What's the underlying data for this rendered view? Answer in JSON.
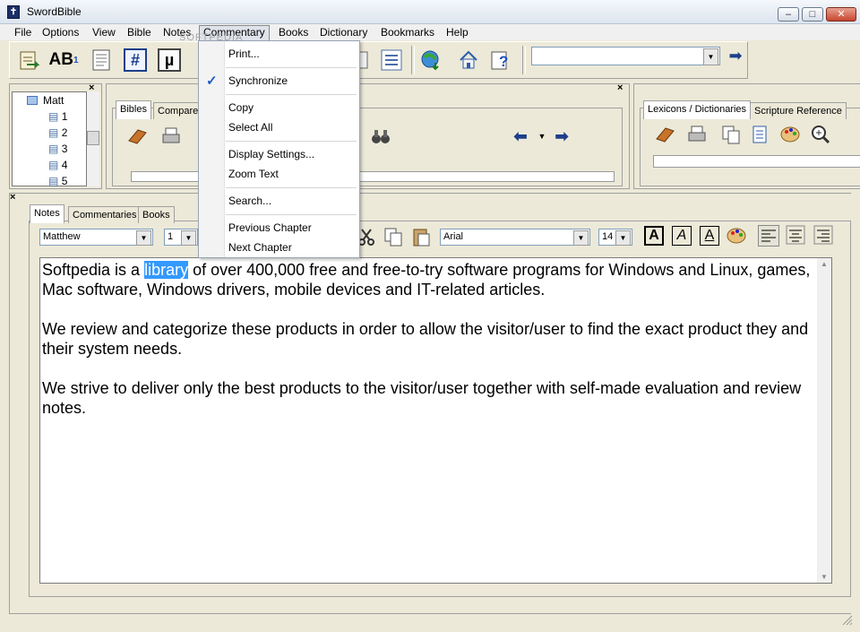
{
  "window": {
    "title": "SwordBible",
    "app_icon_glyph": "✝"
  },
  "window_buttons": {
    "minimize": "–",
    "maximize": "□",
    "close": "✕"
  },
  "menu": [
    "File",
    "Options",
    "View",
    "Bible",
    "Notes",
    "Commentary",
    "Books",
    "Dictionary",
    "Bookmarks",
    "Help"
  ],
  "toolbar": {
    "ab_label": "AB",
    "ab_superscript": "1",
    "hash_label": "#",
    "mu_label": "µ",
    "go_arrow": "➡"
  },
  "watermark": "SOFTPEDIA",
  "tree": {
    "book": "Matt",
    "chapters": [
      "1",
      "2",
      "3",
      "4",
      "5"
    ]
  },
  "bible_panel": {
    "tabs": [
      "Bibles",
      "Compare"
    ]
  },
  "lexicon_panel": {
    "tabs": [
      "Lexicons / Dictionaries",
      "Scripture Reference"
    ]
  },
  "notes_panel": {
    "tabs": [
      "Notes",
      "Commentaries",
      "Books"
    ],
    "book_select": "Matthew",
    "chapter_select": "1",
    "font_select": "Arial",
    "size_select": "14",
    "format_buttons": [
      "A",
      "A",
      "A"
    ]
  },
  "editor": {
    "para1_before": "Softpedia is a ",
    "para1_highlight": "library",
    "para1_after": " of over 400,000 free and free-to-try software programs for Windows and Linux, games, Mac software, Windows drivers, mobile devices and IT-related articles.",
    "para2": "We review and categorize these products in order to allow the visitor/user to find the exact product they and their system needs.",
    "para3": "We strive to deliver only the best products to the visitor/user together with self-made evaluation and review notes."
  },
  "commentary_menu": {
    "print": "Print...",
    "synchronize": "Synchronize",
    "synchronize_checked": true,
    "check_glyph": "✓",
    "copy": "Copy",
    "select_all": "Select All",
    "display_settings": "Display Settings...",
    "zoom_text": "Zoom Text",
    "search": "Search...",
    "previous_chapter": "Previous Chapter",
    "next_chapter": "Next Chapter"
  },
  "colors": {
    "selection": "#3399ff",
    "check": "#1e5bc6"
  }
}
